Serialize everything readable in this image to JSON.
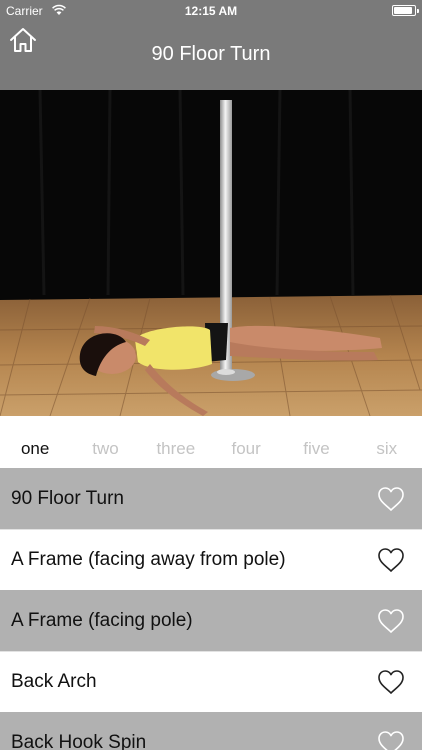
{
  "status_bar": {
    "carrier": "Carrier",
    "time": "12:15 AM",
    "battery_level": 0.9
  },
  "nav": {
    "title": "90 Floor Turn",
    "home_icon": "home-icon"
  },
  "tabs": [
    {
      "label": "one",
      "active": true
    },
    {
      "label": "two",
      "active": false
    },
    {
      "label": "three",
      "active": false
    },
    {
      "label": "four",
      "active": false
    },
    {
      "label": "five",
      "active": false
    },
    {
      "label": "six",
      "active": false
    }
  ],
  "moves": [
    {
      "label": "90 Floor Turn",
      "favorite_icon": "heart-outline-icon"
    },
    {
      "label": "A Frame (facing away from pole)",
      "favorite_icon": "heart-outline-icon"
    },
    {
      "label": "A Frame (facing pole)",
      "favorite_icon": "heart-outline-icon"
    },
    {
      "label": "Back Arch",
      "favorite_icon": "heart-outline-icon"
    },
    {
      "label": "Back Hook Spin",
      "favorite_icon": "heart-outline-icon"
    }
  ],
  "colors": {
    "nav_bar": "#7a7a7a",
    "shaded_row": "#b1b1b1",
    "active_tab": "#111111",
    "inactive_tab": "#c4c4c4"
  }
}
